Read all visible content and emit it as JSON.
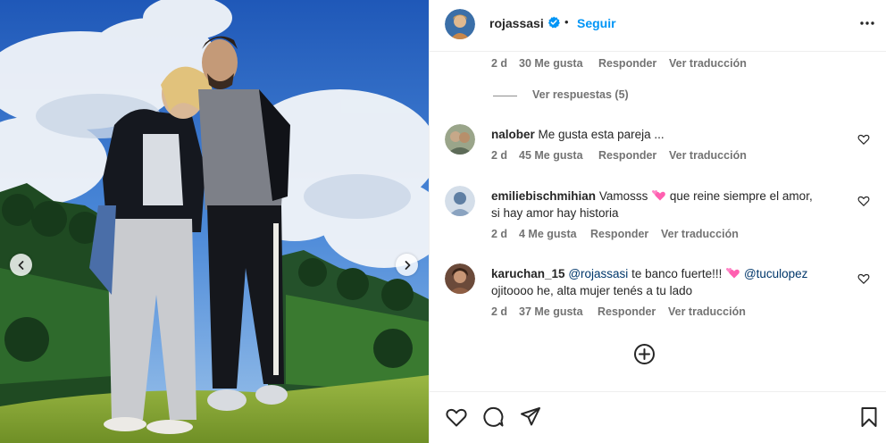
{
  "photo": {
    "prev_icon": "chevron-left-icon",
    "next_icon": "chevron-right-icon"
  },
  "header": {
    "username": "rojassasi",
    "verified_icon": "verified-badge-icon",
    "separator": "•",
    "follow_label": "Seguir",
    "more_icon": "more-options-icon"
  },
  "top_comment_meta": {
    "time": "2 d",
    "likes": "30 Me gusta",
    "reply": "Responder",
    "translate": "Ver traducción"
  },
  "view_replies": "Ver respuestas (5)",
  "comments": [
    {
      "username": "nalober",
      "text_lines": [
        "Me gusta esta pareja ..."
      ],
      "time": "2 d",
      "likes": "45 Me gusta",
      "reply": "Responder",
      "translate": "Ver traducción"
    },
    {
      "username": "emiliebischmihian",
      "text_part1": "Vamosss",
      "text_part2": "que reine siempre el amor,",
      "text_line2": "si hay amor hay historia",
      "time": "2 d",
      "likes": "4 Me gusta",
      "reply": "Responder",
      "translate": "Ver traducción"
    },
    {
      "username": "karuchan_15",
      "mention1": "@rojassasi",
      "text_mid": "te banco fuerte!!!",
      "mention2": "@tuculopez",
      "text_line2": "ojitoooo he, alta mujer tenés a tu lado",
      "time": "2 d",
      "likes": "37 Me gusta",
      "reply": "Responder",
      "translate": "Ver traducción"
    }
  ],
  "add_more_icon": "plus-circle-icon",
  "actions": {
    "like_icon": "heart-icon",
    "comment_icon": "comment-icon",
    "share_icon": "share-icon",
    "save_icon": "bookmark-icon"
  },
  "colors": {
    "link_blue": "#0095f6",
    "mention_blue": "#00376b",
    "text": "#262626",
    "muted": "#737373",
    "heart_emoji": "#ff5fb0"
  }
}
